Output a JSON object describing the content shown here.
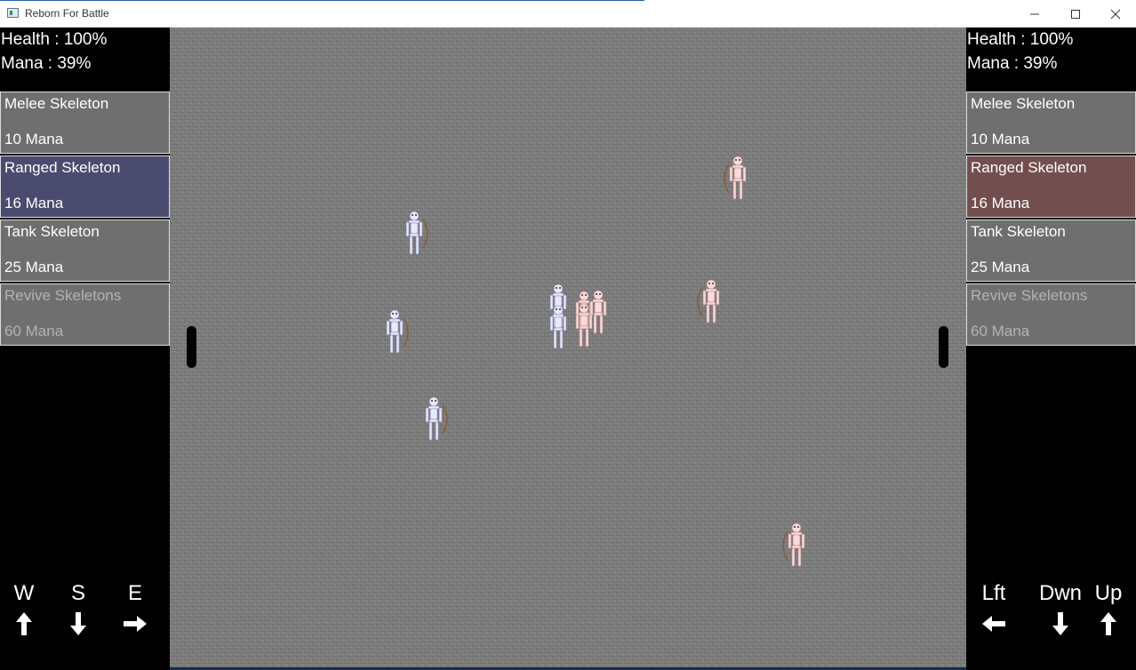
{
  "window": {
    "title": "Reborn For Battle",
    "minimize_icon": "minimize-icon",
    "maximize_icon": "maximize-icon",
    "close_icon": "close-icon"
  },
  "colors": {
    "blue_team": "#e8e8ff",
    "red_team": "#ffd9d9",
    "blue_selected": "#4b4b6f",
    "red_selected": "#734e4f",
    "menu_bg": "#6f6f6f",
    "field": "#7e7e7e"
  },
  "left_player": {
    "health": "Health : 100%",
    "mana": "Mana : 39%",
    "menu": [
      {
        "name": "Melee Skeleton",
        "cost": "10 Mana"
      },
      {
        "name": "Ranged Skeleton",
        "cost": "16 Mana"
      },
      {
        "name": "Tank Skeleton",
        "cost": "25 Mana"
      },
      {
        "name": "Revive Skeletons",
        "cost": "60 Mana"
      }
    ],
    "selected": "Ranged Skeleton",
    "keys": [
      {
        "label": "W",
        "icon": "arrow-up-icon"
      },
      {
        "label": "S",
        "icon": "arrow-down-icon"
      },
      {
        "label": "E",
        "icon": "arrow-right-icon"
      }
    ]
  },
  "right_player": {
    "health": "Health : 100%",
    "mana": "Mana : 39%",
    "menu": [
      {
        "name": "Melee Skeleton",
        "cost": "10 Mana"
      },
      {
        "name": "Ranged Skeleton",
        "cost": "16 Mana"
      },
      {
        "name": "Tank Skeleton",
        "cost": "25 Mana"
      },
      {
        "name": "Revive Skeletons",
        "cost": "60 Mana"
      }
    ],
    "selected": "Ranged Skeleton",
    "keys": [
      {
        "label": "Lft",
        "icon": "arrow-left-icon"
      },
      {
        "label": "Dwn",
        "icon": "arrow-down-icon"
      },
      {
        "label": "Up",
        "icon": "arrow-up-icon"
      }
    ]
  },
  "units": {
    "blue_team": "ranged skeleton",
    "red_team": "ranged skeleton"
  }
}
